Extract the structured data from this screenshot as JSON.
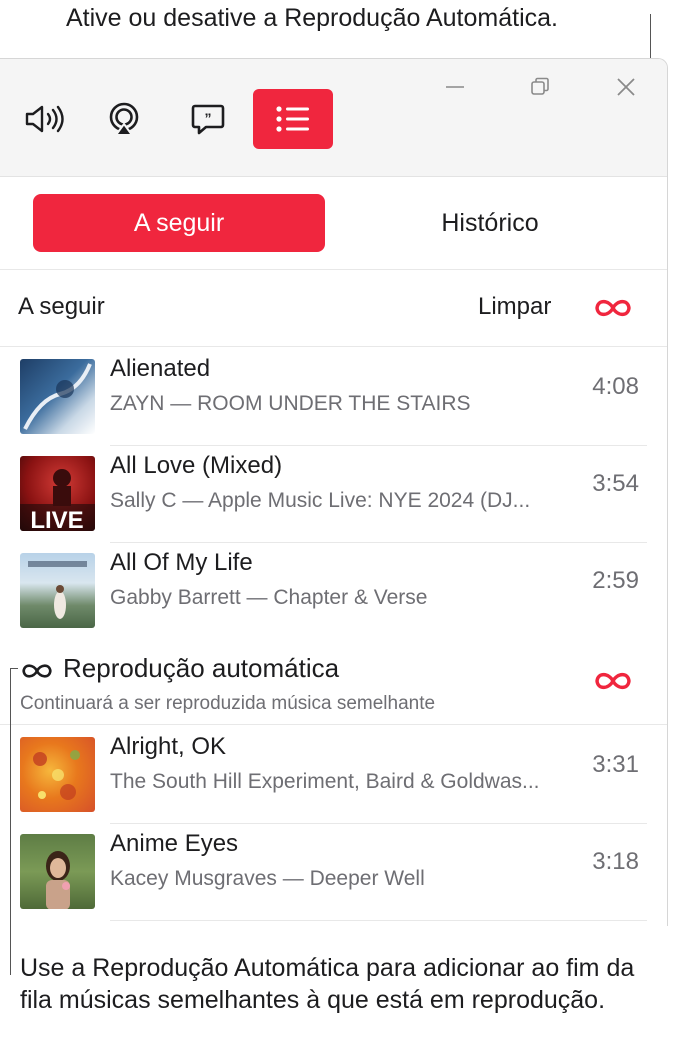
{
  "callouts": {
    "top": "Ative ou desative a Reprodução Automática.",
    "bottom": "Use a Reprodução Automática para adicionar ao fim da fila músicas semelhantes à que está em reprodução."
  },
  "toolbar": {
    "icons": [
      "speaker-volume-icon",
      "airplay-icon",
      "lyrics-icon",
      "playing-next-icon"
    ],
    "window_controls": [
      "minimize-icon",
      "restore-icon",
      "close-icon"
    ]
  },
  "segments": {
    "up_next": "A seguir",
    "history": "Histórico"
  },
  "queue": {
    "header": "A seguir",
    "clear": "Limpar",
    "tracks": [
      {
        "title": "Alienated",
        "subtitle": "ZAYN — ROOM UNDER THE STAIRS",
        "duration": "4:08"
      },
      {
        "title": "All Love (Mixed)",
        "subtitle": "Sally C — Apple Music Live: NYE 2024 (DJ...",
        "duration": "3:54"
      },
      {
        "title": "All Of My Life",
        "subtitle": "Gabby Barrett — Chapter & Verse",
        "duration": "2:59"
      }
    ]
  },
  "autoplay": {
    "title": "Reprodução automática",
    "subtitle": "Continuará a ser reproduzida música semelhante",
    "tracks": [
      {
        "title": "Alright, OK",
        "subtitle": "The South Hill Experiment, Baird & Goldwas...",
        "duration": "3:31"
      },
      {
        "title": "Anime Eyes",
        "subtitle": "Kacey Musgraves — Deeper Well",
        "duration": "3:18"
      }
    ]
  },
  "colors": {
    "accent": "#f0263e",
    "text": "#1d1d1f",
    "secondary_text": "#6e6e73"
  }
}
